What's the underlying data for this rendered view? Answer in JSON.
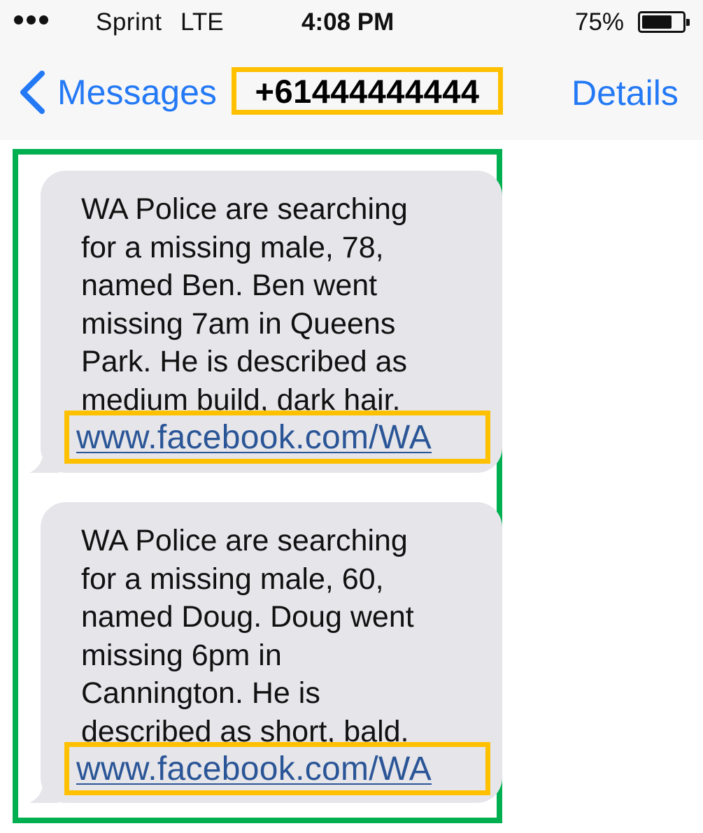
{
  "status_bar": {
    "carrier": "Sprint",
    "network": "LTE",
    "time": "4:08 PM",
    "battery_percent": "75%",
    "battery_level": 0.75
  },
  "nav": {
    "back_label": "Messages",
    "contact": "+61444444444",
    "details_label": "Details"
  },
  "messages": [
    {
      "text": "WA Police are searching\nfor a missing male, 78,\nnamed Ben. Ben went\nmissing 7am in Queens\nPark. He is described as\nmedium build, dark hair.",
      "link": "www.facebook.com/WA"
    },
    {
      "text": "WA Police are searching\nfor a missing male, 60,\nnamed Doug. Doug went\nmissing 6pm in\nCannington. He is\ndescribed as short, bald.",
      "link": "www.facebook.com/WA"
    }
  ],
  "colors": {
    "ios_blue": "#2479f5",
    "bubble_gray": "#e5e5ea",
    "highlight_orange": "#ffc000",
    "highlight_green": "#00b050",
    "link_blue": "#2a5596"
  }
}
